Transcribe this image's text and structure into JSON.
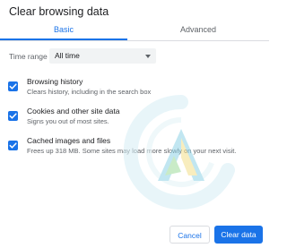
{
  "dialog": {
    "title": "Clear browsing data"
  },
  "tabs": [
    {
      "label": "Basic",
      "active": true
    },
    {
      "label": "Advanced",
      "active": false
    }
  ],
  "time_range": {
    "label": "Time range",
    "selected": "All time"
  },
  "options": [
    {
      "title": "Browsing history",
      "description": "Clears history, including in the search box",
      "checked": true
    },
    {
      "title": "Cookies and other site data",
      "description": "Signs you out of most sites.",
      "checked": true
    },
    {
      "title": "Cached images and files",
      "description": "Frees up 318 MB. Some sites may load more slowly on your next visit.",
      "checked": true
    }
  ],
  "buttons": {
    "cancel": "Cancel",
    "clear": "Clear data"
  },
  "colors": {
    "accent": "#1a73e8",
    "text_primary": "#202124",
    "text_secondary": "#5f6368",
    "select_bg": "#f1f3f4",
    "divider": "#dadce0"
  },
  "icons": {
    "checkbox": "check-icon",
    "dropdown": "caret-down-icon",
    "watermark": "watermark-logo-icon"
  }
}
